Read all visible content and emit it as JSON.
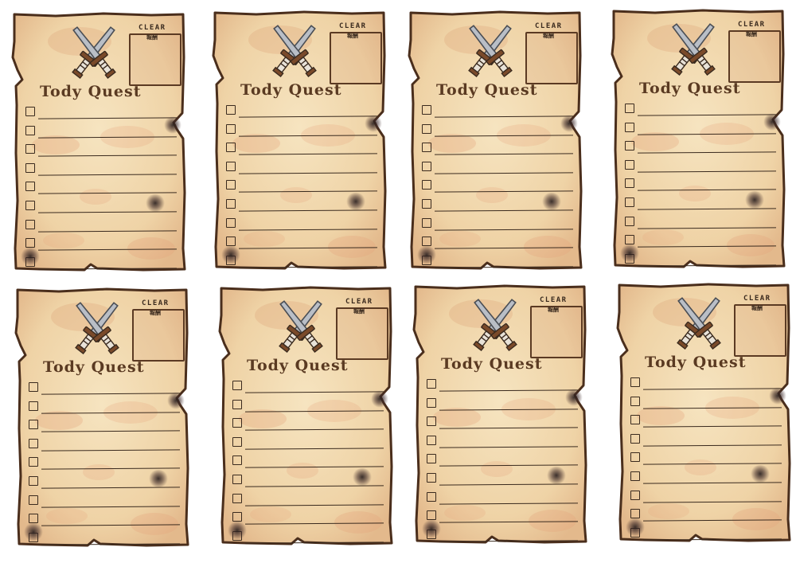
{
  "template": {
    "title": "Tody Quest",
    "clear_label": "CLEAR",
    "reward_label": "報酬",
    "task_count": 9
  },
  "cards": [
    {
      "id": "card-1"
    },
    {
      "id": "card-2"
    },
    {
      "id": "card-3"
    },
    {
      "id": "card-4"
    },
    {
      "id": "card-5"
    },
    {
      "id": "card-6"
    },
    {
      "id": "card-7"
    },
    {
      "id": "card-8"
    }
  ],
  "colors": {
    "paper": "#f3dcb4",
    "paper_stain": "#e9b98f",
    "ink": "#3a2a1e",
    "edge": "#4a2e1c",
    "title_brown": "#5a3a22",
    "blade": "#b9bec6"
  },
  "icons": [
    "crossed-swords-icon",
    "checkbox-icon",
    "burn-mark-icon"
  ]
}
